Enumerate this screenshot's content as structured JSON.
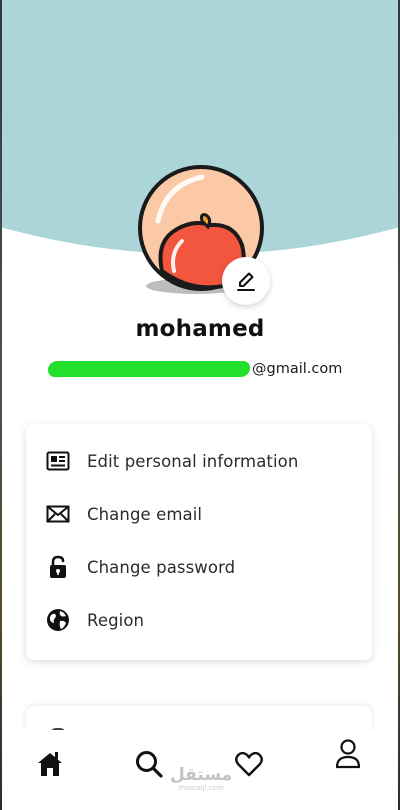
{
  "profile": {
    "username": "mohamed",
    "email_domain": "@gmail.com"
  },
  "settings_menu": {
    "items": [
      {
        "label": "Edit personal information",
        "icon": "id-card-icon"
      },
      {
        "label": "Change email",
        "icon": "envelope-icon"
      },
      {
        "label": "Change password",
        "icon": "unlocked-padlock-icon"
      },
      {
        "label": "Region",
        "icon": "globe-icon"
      }
    ]
  },
  "bottom_nav": {
    "items": [
      {
        "icon": "home-icon",
        "active": true
      },
      {
        "icon": "search-icon",
        "active": false
      },
      {
        "icon": "heart-icon",
        "active": false
      },
      {
        "icon": "user-icon",
        "active": false
      }
    ]
  },
  "watermark": {
    "text": "مستقل",
    "subtext": "mostaql.com"
  },
  "colors": {
    "header_background": "#abd5d8",
    "avatar_peach": "#fcc9a6",
    "avatar_tomato": "#f2563e",
    "email_redaction": "#22e02c",
    "text_primary": "#111111"
  }
}
